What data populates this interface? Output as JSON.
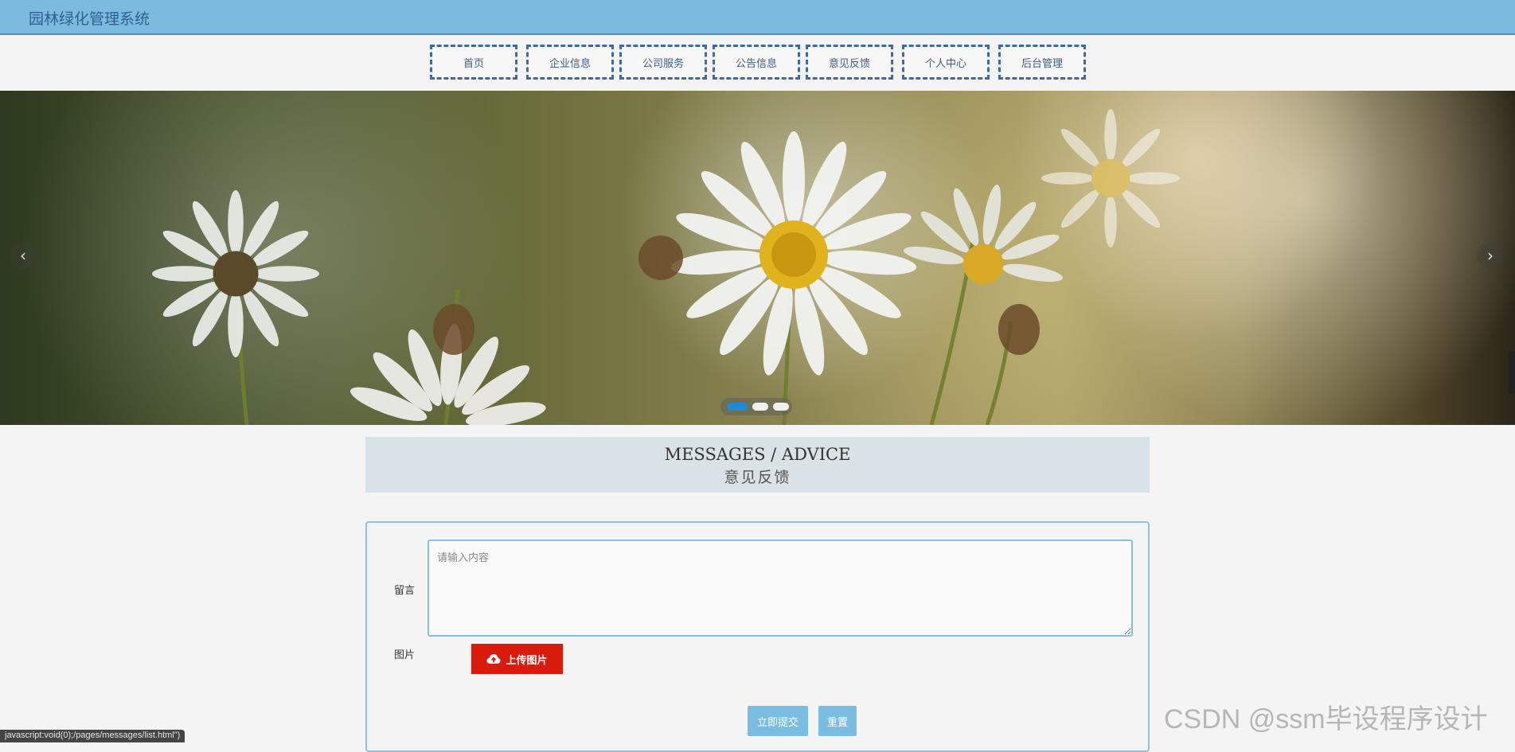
{
  "header": {
    "site_title": "园林绿化管理系统"
  },
  "nav": {
    "items": [
      {
        "label": "首页"
      },
      {
        "label": "企业信息"
      },
      {
        "label": "公司服务"
      },
      {
        "label": "公告信息"
      },
      {
        "label": "意见反馈"
      },
      {
        "label": "个人中心"
      },
      {
        "label": "后台管理"
      }
    ]
  },
  "carousel": {
    "prev_icon": "chevron-left-icon",
    "next_icon": "chevron-right-icon",
    "prev_glyph": "‹",
    "next_glyph": "›",
    "slide_count": 3,
    "active_index": 0
  },
  "section": {
    "title_en": "MESSAGES / ADVICE",
    "title_cn": "意见反馈"
  },
  "form": {
    "message_label": "留言",
    "message_placeholder": "请输入内容",
    "message_value": "",
    "image_label": "图片",
    "upload_label": "上传图片",
    "submit_label": "立即提交",
    "reset_label": "重置"
  },
  "status_bar": {
    "url_text": "javascript:void(0);/pages/messages/list.html\")"
  },
  "watermark": "CSDN @ssm毕设程序设计",
  "colors": {
    "header_bg": "#7cbbe0",
    "nav_border": "#3f6aa5",
    "upload_button": "#d81b0c",
    "action_button": "#7bbde0",
    "active_dot": "#1e8ad6"
  }
}
